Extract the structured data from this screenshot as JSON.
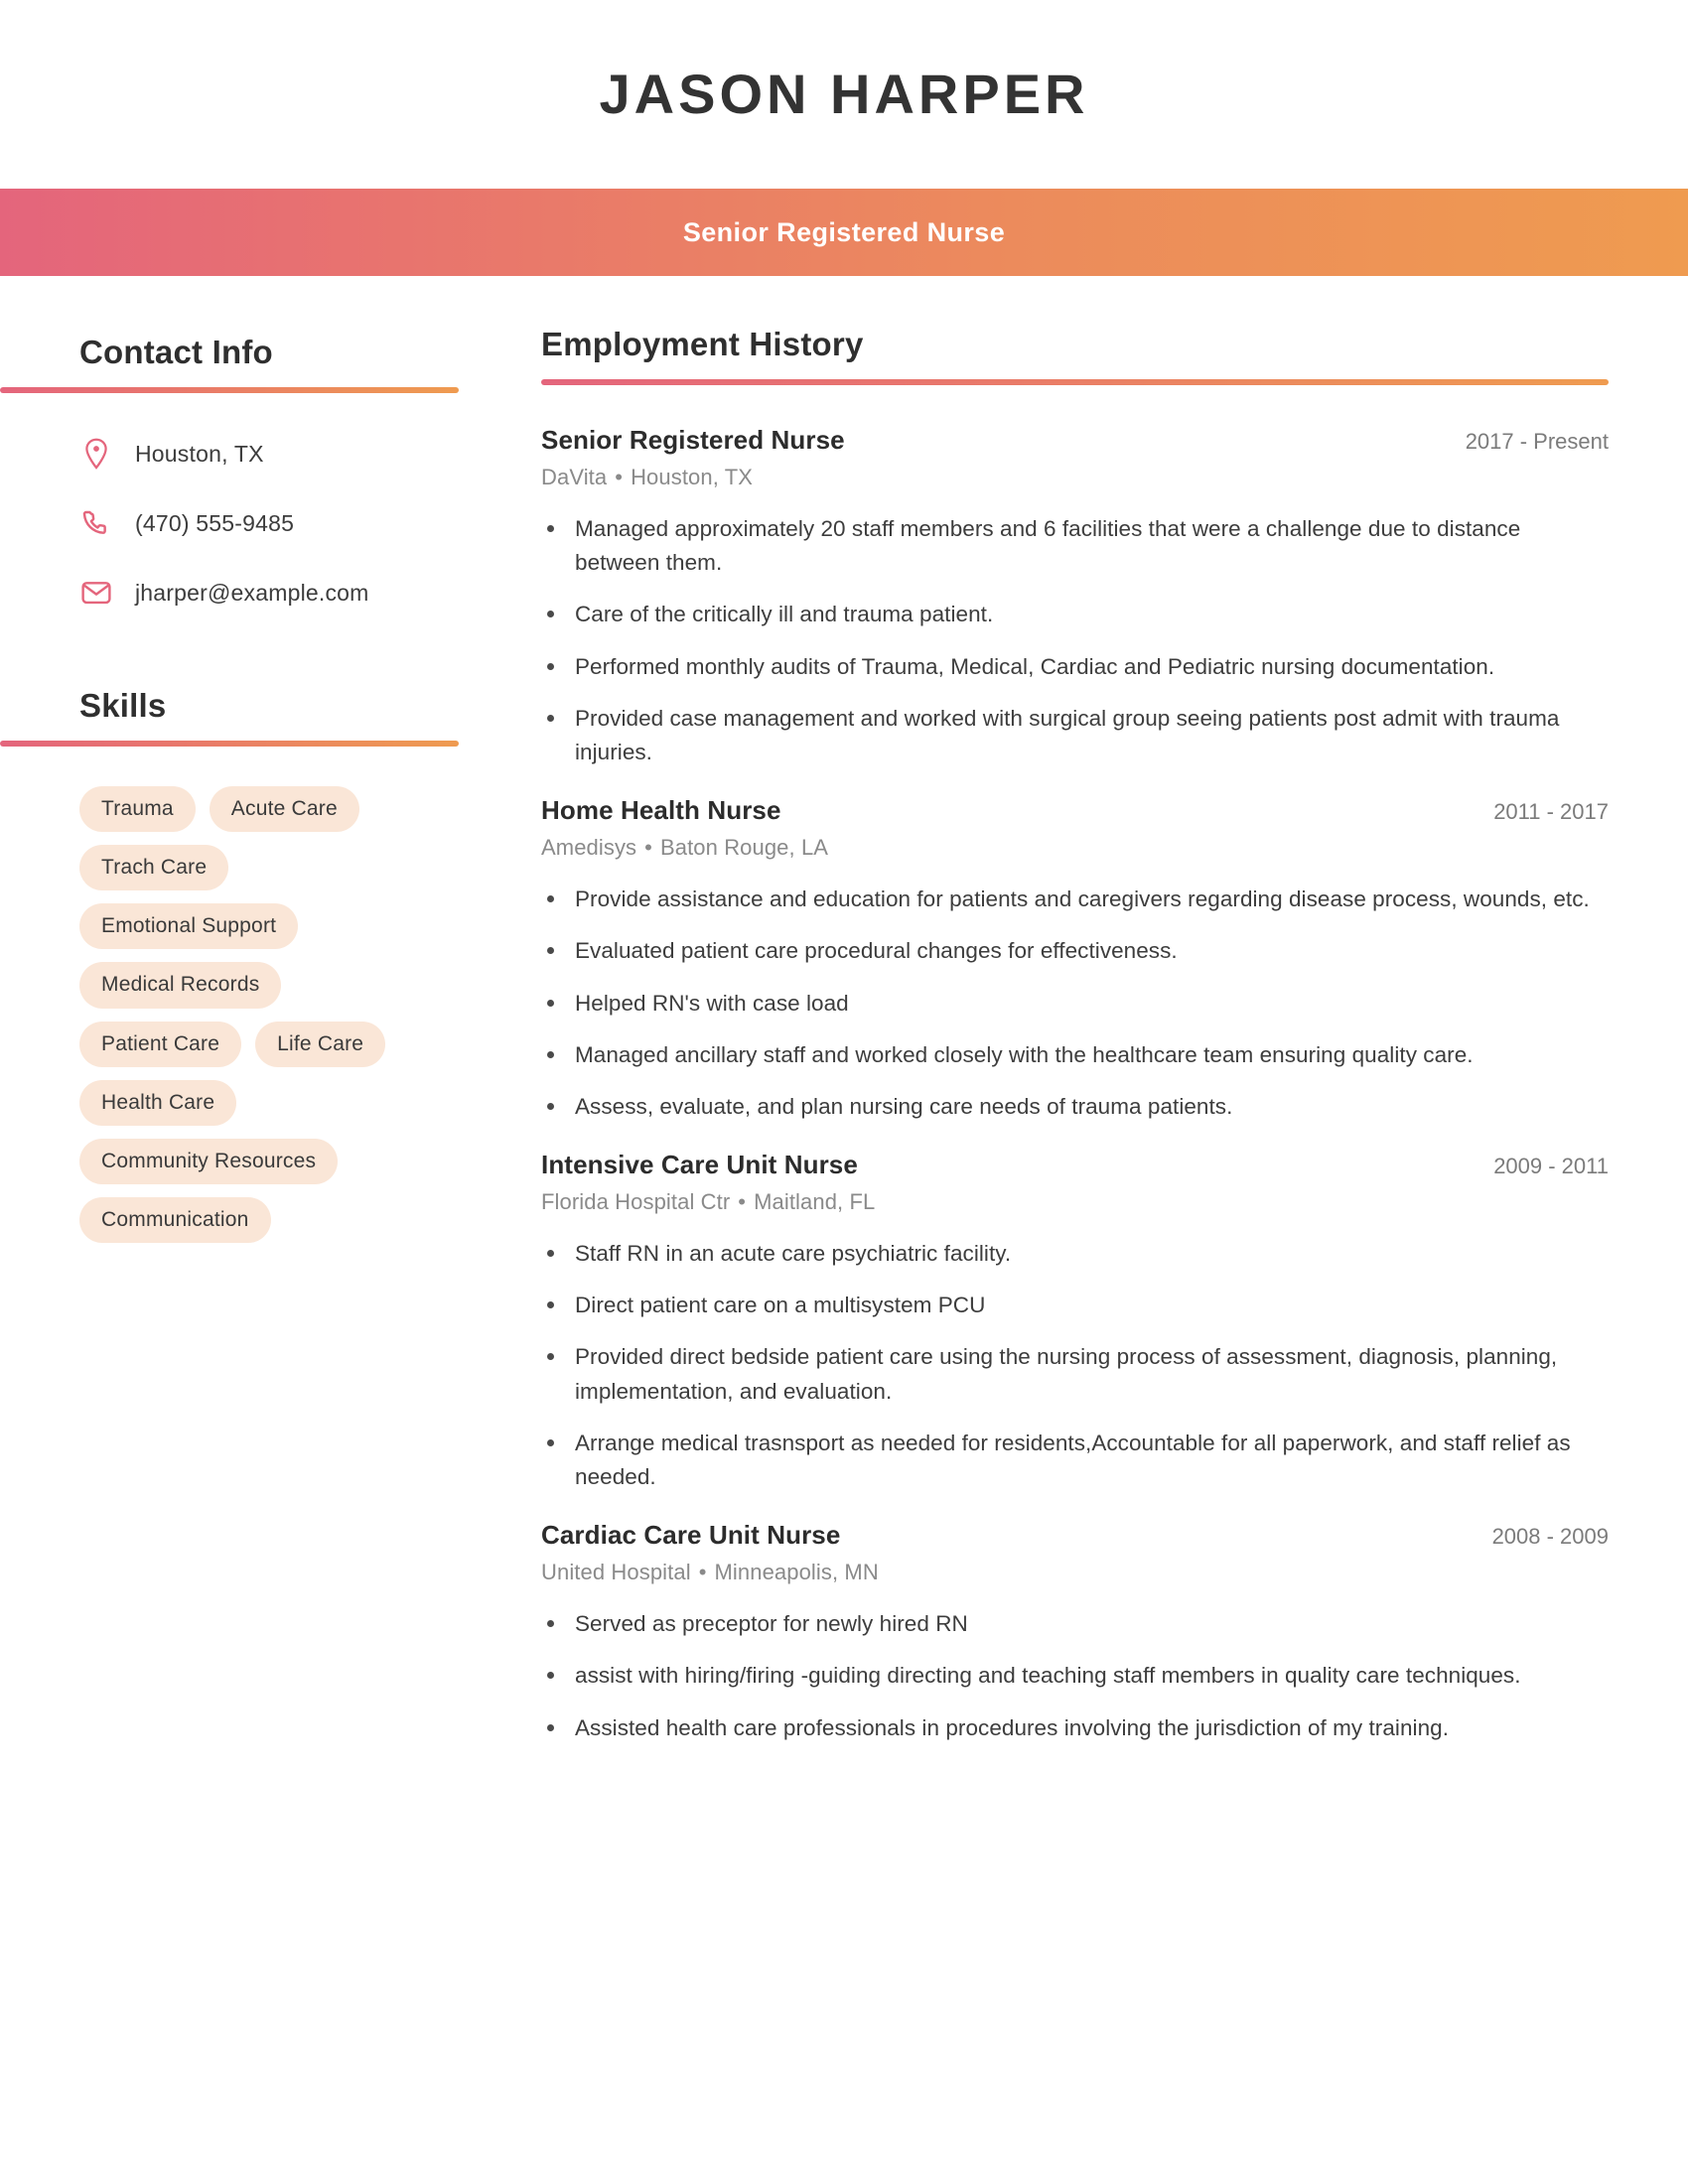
{
  "theme": {
    "gradient_start": "#e4657c",
    "gradient_end": "#ef9b50",
    "icon_color": "#e4657c",
    "pill_bg": "#fae6d7",
    "name_color": "#333333"
  },
  "header": {
    "full_name": "JASON HARPER",
    "job_title": "Senior Registered Nurse"
  },
  "sidebar": {
    "contact": {
      "heading": "Contact Info",
      "items": [
        {
          "icon": "location-pin-icon",
          "value": "Houston, TX"
        },
        {
          "icon": "phone-icon",
          "value": "(470) 555-9485"
        },
        {
          "icon": "envelope-icon",
          "value": "jharper@example.com"
        }
      ]
    },
    "skills": {
      "heading": "Skills",
      "items": [
        "Trauma",
        "Acute Care",
        "Trach Care",
        "Emotional Support",
        "Medical Records",
        "Patient Care",
        "Life Care",
        "Health Care",
        "Community Resources",
        "Communication"
      ]
    }
  },
  "main": {
    "employment": {
      "heading": "Employment History",
      "separator": "•",
      "jobs": [
        {
          "role": "Senior Registered Nurse",
          "dates": "2017 - Present",
          "company": "DaVita",
          "location": "Houston, TX",
          "bullets": [
            "Managed approximately 20 staff members and 6 facilities that were a challenge due to distance between them.",
            "Care of the critically ill and trauma patient.",
            "Performed monthly audits of Trauma, Medical, Cardiac and Pediatric nursing documentation.",
            "Provided case management and worked with surgical group seeing patients post admit with trauma injuries."
          ]
        },
        {
          "role": "Home Health Nurse",
          "dates": "2011 - 2017",
          "company": "Amedisys",
          "location": "Baton Rouge, LA",
          "bullets": [
            "Provide assistance and education for patients and caregivers regarding disease process, wounds, etc.",
            "Evaluated patient care procedural changes for effectiveness.",
            "Helped RN's with case load",
            "Managed ancillary staff and worked closely with the healthcare team ensuring quality care.",
            "Assess, evaluate, and plan nursing care needs of trauma patients."
          ]
        },
        {
          "role": "Intensive Care Unit Nurse",
          "dates": "2009 - 2011",
          "company": "Florida Hospital Ctr",
          "location": "Maitland, FL",
          "bullets": [
            "Staff RN in an acute care psychiatric facility.",
            "Direct patient care on a multisystem PCU",
            "Provided direct bedside patient care using the nursing process of assessment, diagnosis, planning, implementation, and evaluation.",
            "Arrange medical trasnsport as needed for residents,Accountable for all paperwork, and staff relief as needed."
          ]
        },
        {
          "role": "Cardiac Care Unit Nurse",
          "dates": "2008 - 2009",
          "company": "United Hospital",
          "location": "Minneapolis, MN",
          "bullets": [
            "Served as preceptor for newly hired RN",
            "assist with hiring/firing -guiding directing and teaching staff members in quality care techniques.",
            "Assisted health care professionals in procedures involving the jurisdiction of my training."
          ]
        }
      ]
    }
  }
}
